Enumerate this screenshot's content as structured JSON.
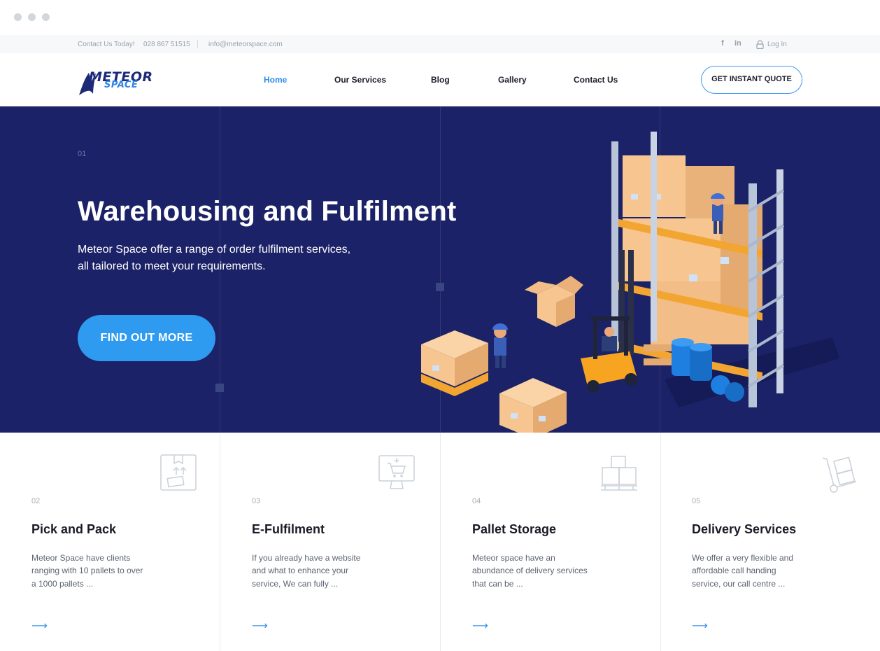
{
  "window": {
    "controls": [
      "close",
      "minimize",
      "maximize"
    ]
  },
  "topbar": {
    "contact_label": "Contact Us Today!",
    "phone": "028 867 51515",
    "email": "info@meteorspace.com",
    "facebook_glyph": "f",
    "linkedin_glyph": "in",
    "login_label": "Log In"
  },
  "header": {
    "logo_top": "METEOR",
    "logo_bottom": "SPACE",
    "nav": [
      {
        "label": "Home",
        "active": true
      },
      {
        "label": "Our Services",
        "active": false
      },
      {
        "label": "Blog",
        "active": false
      },
      {
        "label": "Gallery",
        "active": false
      },
      {
        "label": "Contact Us",
        "active": false
      }
    ],
    "quote_button": "GET INSTANT QUOTE"
  },
  "hero": {
    "number": "01",
    "title": "Warehousing and Fulfilment",
    "subtitle_line1": "Meteor Space offer a range of order fulfilment services,",
    "subtitle_line2": "all tailored to meet your requirements.",
    "cta": "FIND OUT MORE"
  },
  "services": [
    {
      "number": "02",
      "title": "Pick and Pack",
      "description": "Meteor Space have clients ranging with 10 pallets to over a 1000 pallets ...",
      "icon": "package-box-icon",
      "arrow": "⟶"
    },
    {
      "number": "03",
      "title": "E-Fulfilment",
      "description": "If you already have a website and what to enhance your service, We can fully ...",
      "icon": "monitor-cart-icon",
      "arrow": "⟶"
    },
    {
      "number": "04",
      "title": "Pallet Storage",
      "description": "Meteor space have an abundance of delivery services that can be ...",
      "icon": "pallet-boxes-icon",
      "arrow": "⟶"
    },
    {
      "number": "05",
      "title": "Delivery Services",
      "description": "We offer a very flexible and affordable call handing service, our call centre ...",
      "icon": "hand-truck-icon",
      "arrow": "⟶"
    }
  ],
  "colors": {
    "brand_navy": "#1b2267",
    "accent_blue": "#2e9bf0",
    "logo_dark": "#1c2a78",
    "text_dark": "#1d1d2b"
  }
}
